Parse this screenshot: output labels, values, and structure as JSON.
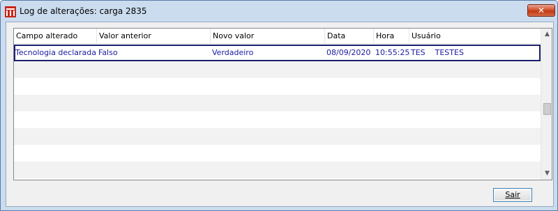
{
  "window": {
    "title": "Log de alterações: carga 2835",
    "close_label": "✕"
  },
  "table": {
    "columns": [
      "Campo alterado",
      "Valor anterior",
      "Novo valor",
      "Data",
      "Hora",
      "Usuário"
    ],
    "rows": [
      {
        "campo": "Tecnologia declarada",
        "anterior": "Falso",
        "novo": "Verdadeiro",
        "data": "08/09/2020",
        "hora": "10:55:25",
        "usuario": "TES    TESTES"
      }
    ]
  },
  "scroll": {
    "up_arrow": "▲",
    "down_arrow": "▼"
  },
  "buttons": {
    "exit_label": "Sair"
  },
  "colors": {
    "row_text": "#1a1a9e",
    "selection_border": "#1b1f6b",
    "close_button": "#c43b16"
  }
}
